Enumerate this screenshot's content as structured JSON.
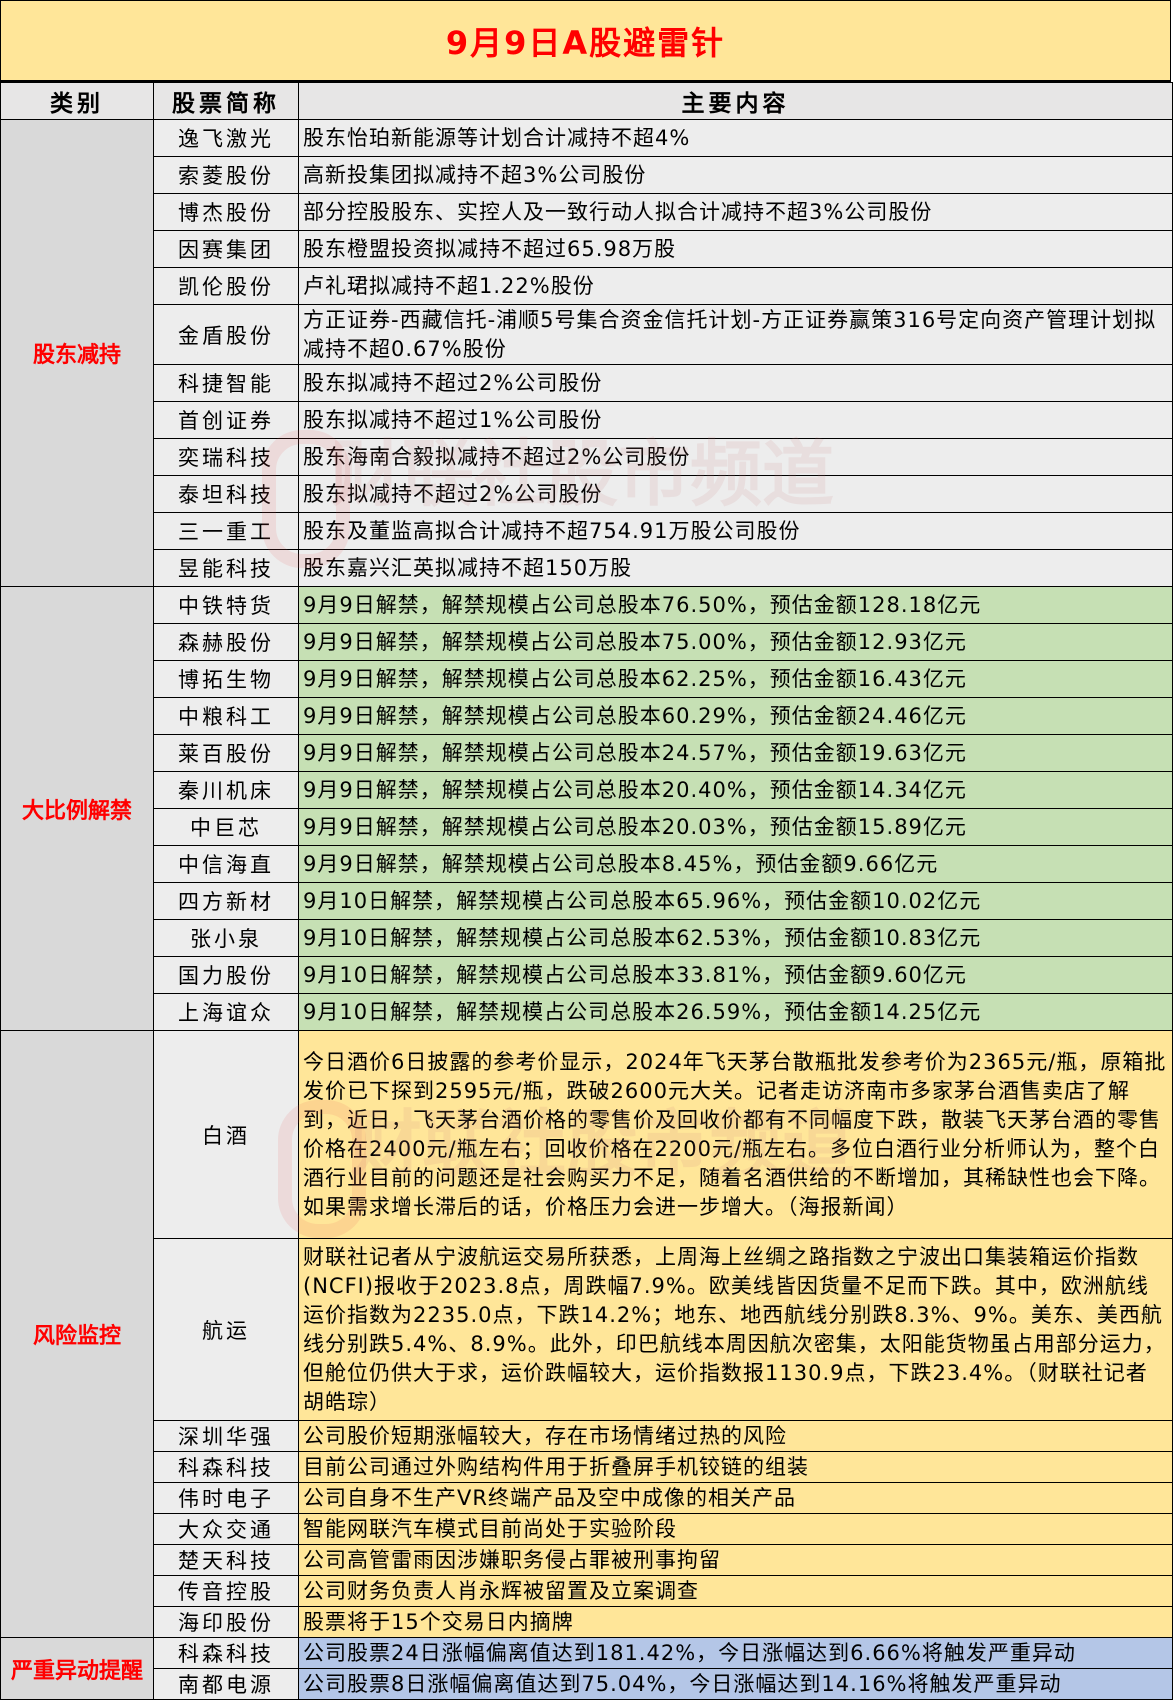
{
  "title": "9月9日A股避雷针",
  "watermark": "财联社股市频道",
  "colors": {
    "title_bg": "#FFE699",
    "title_text": "#FF0000",
    "category_text": "#FF0000",
    "reduce_bg": "#EDEDED",
    "unlock_bg": "#C6E0B4",
    "risk_bg": "#FFE699",
    "alert_bg": "#B4C6E7"
  },
  "headers": {
    "category": "类别",
    "stock": "股票简称",
    "content": "主要内容"
  },
  "sections": [
    {
      "category": "股东减持",
      "bg": "gray",
      "rows": [
        {
          "stock": "逸飞激光",
          "content": "股东怡珀新能源等计划合计减持不超4%"
        },
        {
          "stock": "索菱股份",
          "content": "高新投集团拟减持不超3%公司股份"
        },
        {
          "stock": "博杰股份",
          "content": "部分控股股东、实控人及一致行动人拟合计减持不超3%公司股份"
        },
        {
          "stock": "因赛集团",
          "content": "股东橙盟投资拟减持不超过65.98万股"
        },
        {
          "stock": "凯伦股份",
          "content": "卢礼珺拟减持不超1.22%股份"
        },
        {
          "stock": "金盾股份",
          "content": "方正证券-西藏信托-浦顺5号集合资金信托计划-方正证券赢策316号定向资产管理计划拟减持不超0.67%股份",
          "h": 60
        },
        {
          "stock": "科捷智能",
          "content": "股东拟减持不超过2%公司股份"
        },
        {
          "stock": "首创证券",
          "content": "股东拟减持不超过1%公司股份"
        },
        {
          "stock": "奕瑞科技",
          "content": "股东海南合毅拟减持不超过2%公司股份"
        },
        {
          "stock": "泰坦科技",
          "content": "股东拟减持不超过2%公司股份"
        },
        {
          "stock": "三一重工",
          "content": "股东及董监高拟合计减持不超754.91万股公司股份"
        },
        {
          "stock": "昱能科技",
          "content": "股东嘉兴汇英拟减持不超150万股"
        }
      ]
    },
    {
      "category": "大比例解禁",
      "bg": "green",
      "rows": [
        {
          "stock": "中铁特货",
          "content": "9月9日解禁，解禁规模占公司总股本76.50%，预估金额128.18亿元"
        },
        {
          "stock": "森赫股份",
          "content": "9月9日解禁，解禁规模占公司总股本75.00%，预估金额12.93亿元"
        },
        {
          "stock": "博拓生物",
          "content": "9月9日解禁，解禁规模占公司总股本62.25%，预估金额16.43亿元"
        },
        {
          "stock": "中粮科工",
          "content": "9月9日解禁，解禁规模占公司总股本60.29%，预估金额24.46亿元"
        },
        {
          "stock": "莱百股份",
          "content": "9月9日解禁，解禁规模占公司总股本24.57%，预估金额19.63亿元"
        },
        {
          "stock": "秦川机床",
          "content": "9月9日解禁，解禁规模占公司总股本20.40%，预估金额14.34亿元"
        },
        {
          "stock": "中巨芯",
          "content": "9月9日解禁，解禁规模占公司总股本20.03%，预估金额15.89亿元"
        },
        {
          "stock": "中信海直",
          "content": "9月9日解禁，解禁规模占公司总股本8.45%，预估金额9.66亿元"
        },
        {
          "stock": "四方新材",
          "content": "9月10日解禁，解禁规模占公司总股本65.96%，预估金额10.02亿元"
        },
        {
          "stock": "张小泉",
          "content": "9月10日解禁，解禁规模占公司总股本62.53%，预估金额10.83亿元"
        },
        {
          "stock": "国力股份",
          "content": "9月10日解禁，解禁规模占公司总股本33.81%，预估金额9.60亿元"
        },
        {
          "stock": "上海谊众",
          "content": "9月10日解禁，解禁规模占公司总股本26.59%，预估金额14.25亿元"
        }
      ]
    },
    {
      "category": "风险监控",
      "bg": "yellow",
      "rows": [
        {
          "stock": "白酒",
          "content": "今日酒价6日披露的参考价显示，2024年飞天茅台散瓶批发参考价为2365元/瓶，原箱批发价已下探到2595元/瓶，跌破2600元大关。记者走访济南市多家茅台酒售卖店了解到，近日，飞天茅台酒价格的零售价及回收价都有不同幅度下跌，散装飞天茅台酒的零售价格在2400元/瓶左右；回收价格在2200元/瓶左右。多位白酒行业分析师认为，整个白酒行业目前的问题还是社会购买力不足，随着名酒供给的不断增加，其稀缺性也会下降。如果需求增长滞后的话，价格压力会进一步增大。（海报新闻）",
          "h": 208
        },
        {
          "stock": "航运",
          "content": "财联社记者从宁波航运交易所获悉，上周海上丝绸之路指数之宁波出口集装箱运价指数(NCFI)报收于2023.8点，周跌幅7.9%。欧美线皆因货量不足而下跌。其中，欧洲航线运价指数为2235.0点，下跌14.2%；地东、地西航线分别跌8.3%、9%。美东、美西航线分别跌5.4%、8.9%。此外，印巴航线本周因航次密集，太阳能货物虽占用部分运力，但舱位仍供大于求，运价跌幅较大，运价指数报1130.9点，下跌23.4%。（财联社记者 胡皓琮）",
          "h": 182
        },
        {
          "stock": "深圳华强",
          "content": "公司股价短期涨幅较大，存在市场情绪过热的风险",
          "h": 30
        },
        {
          "stock": "科森科技",
          "content": "目前公司通过外购结构件用于折叠屏手机铰链的组装",
          "h": 30
        },
        {
          "stock": "伟时电子",
          "content": "公司自身不生产VR终端产品及空中成像的相关产品",
          "h": 30
        },
        {
          "stock": "大众交通",
          "content": "智能网联汽车模式目前尚处于实验阶段",
          "h": 30
        },
        {
          "stock": "楚天科技",
          "content": "公司高管雷雨因涉嫌职务侵占罪被刑事拘留",
          "h": 30
        },
        {
          "stock": "传音控股",
          "content": "公司财务负责人肖永辉被留置及立案调查",
          "h": 30
        },
        {
          "stock": "海印股份",
          "content": "股票将于15个交易日内摘牌",
          "h": 30
        }
      ]
    },
    {
      "category": "严重异动提醒",
      "bg": "blue",
      "rows": [
        {
          "stock": "科森科技",
          "content": "公司股票24日涨幅偏离值达到181.42%，今日涨幅达到6.66%将触发严重异动",
          "h": 30
        },
        {
          "stock": "南都电源",
          "content": "公司股票8日涨幅偏离值达到75.04%，今日涨幅达到14.16%将触发严重异动",
          "h": 30
        }
      ]
    }
  ]
}
